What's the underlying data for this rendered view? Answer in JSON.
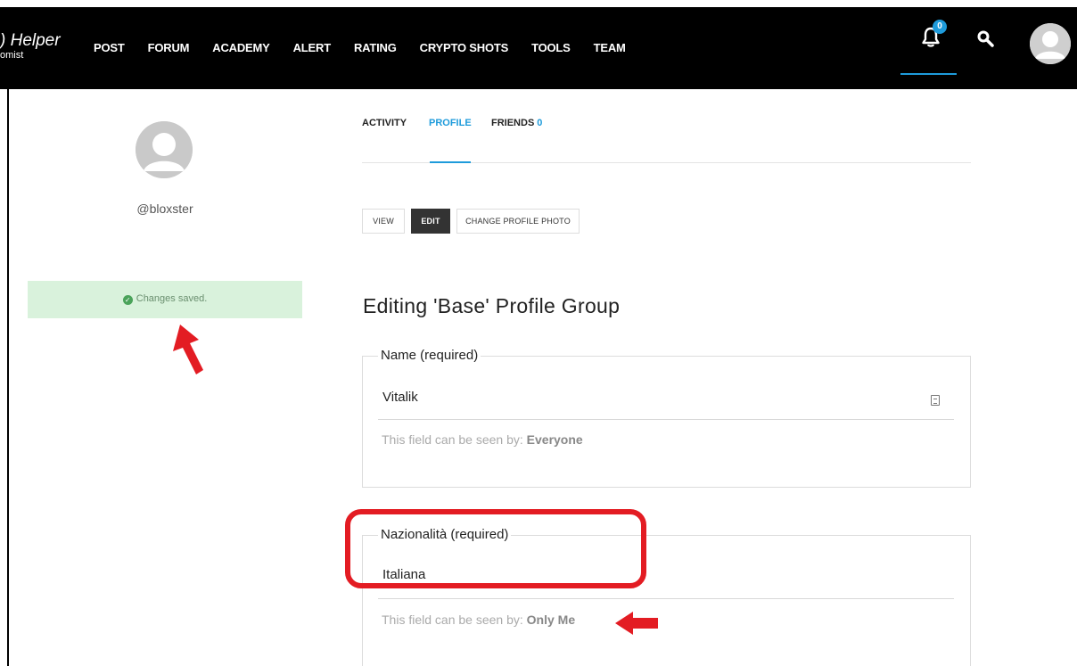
{
  "header": {
    "logo_line1": ") Helper",
    "logo_line2": "omist",
    "nav": [
      "POST",
      "FORUM",
      "ACADEMY",
      "ALERT",
      "RATING",
      "CRYPTO SHOTS",
      "TOOLS",
      "TEAM"
    ],
    "notification_count": "0",
    "accent_color": "#1e9bdb"
  },
  "profile": {
    "handle": "@bloxster",
    "notice": "Changes saved."
  },
  "tabs": {
    "activity": "ACTIVITY",
    "profile": "PROFILE",
    "friends": "FRIENDS",
    "friends_count": "0"
  },
  "subnav": {
    "view": "VIEW",
    "edit": "EDIT",
    "change_photo": "CHANGE PROFILE PHOTO"
  },
  "main": {
    "heading": "Editing 'Base' Profile Group",
    "fields": [
      {
        "legend": "Name (required)",
        "value": "Vitalik",
        "visibility_prefix": "This field can be seen by: ",
        "visibility_value": "Everyone"
      },
      {
        "legend": "Nazionalità (required)",
        "value": "Italiana",
        "visibility_prefix": "This field can be seen by: ",
        "visibility_value": "Only Me"
      }
    ]
  },
  "annotation_color": "#e31c23"
}
